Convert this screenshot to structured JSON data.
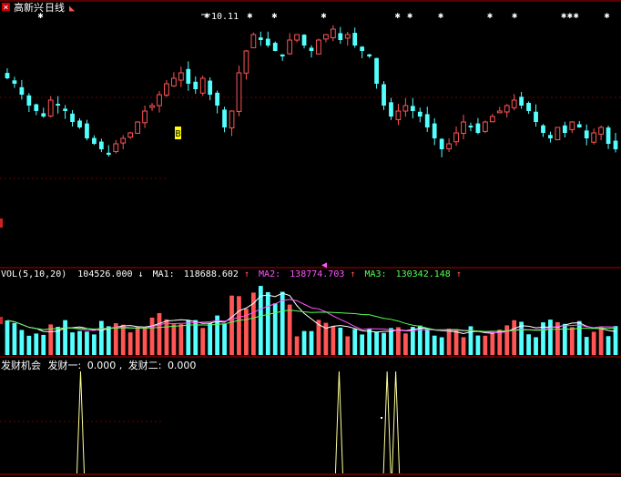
{
  "header": {
    "stock_name": "高新兴",
    "period": "日线",
    "high_label": "10.11"
  },
  "volume_panel": {
    "label": "VOL(5,10,20)",
    "vol_value": "104526.000",
    "vol_arrow": "↓",
    "ma1_label": "MA1:",
    "ma1_value": "118688.602",
    "ma1_arrow": "↑",
    "ma2_label": "MA2:",
    "ma2_value": "138774.703",
    "ma2_arrow": "↑",
    "ma3_label": "MA3:",
    "ma3_value": "130342.148",
    "ma3_arrow": "↑"
  },
  "indicator_panel": {
    "name": "发财机会",
    "line1_label": "发财一:",
    "line1_value": "0.000",
    "line2_label": "发财二:",
    "line2_value": "0.000"
  },
  "colors": {
    "up_candle": "#ff5555",
    "down_candle": "#54ffff",
    "frame": "#b00000",
    "vol_text": "#ffffff",
    "ma1": "#ffffff",
    "ma2": "#ff55ff",
    "ma3": "#55ff55",
    "signal_line": "#ffff99",
    "signal_marker": "#ffff00"
  },
  "chart_data": [
    {
      "type": "candlestick",
      "description_visible": "daily price candles",
      "price_range": [
        7.2,
        10.3
      ],
      "high_marker_value": 10.11,
      "series": [
        {
          "name": "price",
          "closes": [
            9.1,
            9.0,
            8.8,
            8.6,
            8.5,
            8.4,
            8.7,
            8.6,
            8.5,
            8.3,
            8.2,
            8.0,
            7.9,
            7.8,
            7.7,
            7.9,
            8.0,
            8.1,
            8.3,
            8.5,
            8.6,
            8.8,
            9.0,
            9.1,
            9.2,
            9.0,
            8.9,
            9.1,
            8.8,
            8.6,
            8.2,
            8.5,
            9.2,
            9.6,
            9.9,
            9.8,
            9.7,
            9.6,
            9.5,
            9.8,
            9.9,
            9.7,
            9.6,
            9.8,
            9.9,
            10.0,
            9.8,
            9.9,
            9.7,
            9.6,
            9.5,
            9.0,
            8.6,
            8.4,
            8.5,
            8.6,
            8.5,
            8.4,
            8.2,
            8.0,
            7.8,
            7.9,
            8.1,
            8.3,
            8.2,
            8.1,
            8.3,
            8.4,
            8.5,
            8.6,
            8.7,
            8.6,
            8.5,
            8.3,
            8.1,
            8.0,
            8.2,
            8.1,
            8.3,
            8.2,
            8.0,
            8.1,
            8.2,
            7.9,
            7.8
          ]
        }
      ]
    },
    {
      "type": "bar",
      "description_visible": "volume bars with MA lines",
      "series": [
        {
          "name": "MA1"
        },
        {
          "name": "MA2"
        },
        {
          "name": "MA3"
        }
      ]
    },
    {
      "type": "line",
      "description_visible": "signal spikes",
      "series": [
        {
          "name": "发财一",
          "spike_positions": [
            0.125,
            0.545,
            0.623,
            0.637
          ]
        }
      ]
    }
  ]
}
